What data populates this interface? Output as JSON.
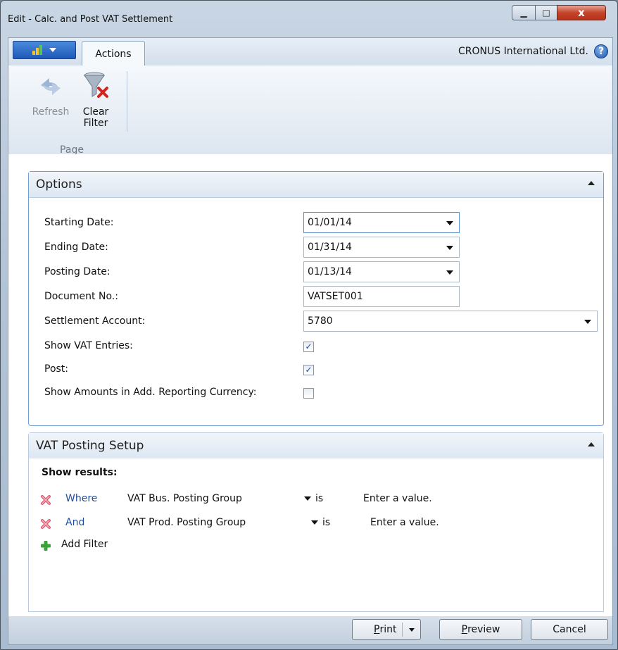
{
  "window": {
    "title": "Edit - Calc. and Post VAT Settlement",
    "minimize": "▁",
    "maximize": "□",
    "close": "x"
  },
  "ribbon": {
    "tab_actions": "Actions",
    "company": "CRONUS International Ltd.",
    "help": "?",
    "refresh_label": "Refresh",
    "clear_label_1": "Clear",
    "clear_label_2": "Filter",
    "group_label": "Page"
  },
  "options": {
    "header": "Options",
    "fields": {
      "starting_date": {
        "label": "Starting Date:",
        "value": "01/01/14"
      },
      "ending_date": {
        "label": "Ending Date:",
        "value": "01/31/14"
      },
      "posting_date": {
        "label": "Posting Date:",
        "value": "01/13/14"
      },
      "document_no": {
        "label": "Document No.:",
        "value": "VATSET001"
      },
      "settlement_account": {
        "label": "Settlement Account:",
        "value": "5780"
      },
      "show_vat_entries": {
        "label": "Show VAT Entries:",
        "checked": true,
        "mark": "✓"
      },
      "post": {
        "label": "Post:",
        "checked": true,
        "mark": "✓"
      },
      "show_amounts": {
        "label": "Show Amounts in Add. Reporting Currency:",
        "checked": false,
        "mark": ""
      }
    }
  },
  "vat_setup": {
    "header": "VAT Posting Setup",
    "show_results": "Show results:",
    "filters": [
      {
        "keyword": "Where",
        "field": "VAT Bus. Posting Group",
        "operator": "is",
        "value": "Enter a value."
      },
      {
        "keyword": "And",
        "field": "VAT Prod. Posting Group",
        "operator": "is",
        "value": "Enter a value."
      }
    ],
    "add_filter": "Add Filter"
  },
  "footer": {
    "print": "Print",
    "print_key": "P",
    "print_rest": "rint",
    "preview_key": "P",
    "preview_rest": "review",
    "cancel": "Cancel"
  },
  "colors": {
    "accent": "#1f4c9b",
    "panel_border": "#6f9fd6",
    "close_button": "#c4452c"
  }
}
